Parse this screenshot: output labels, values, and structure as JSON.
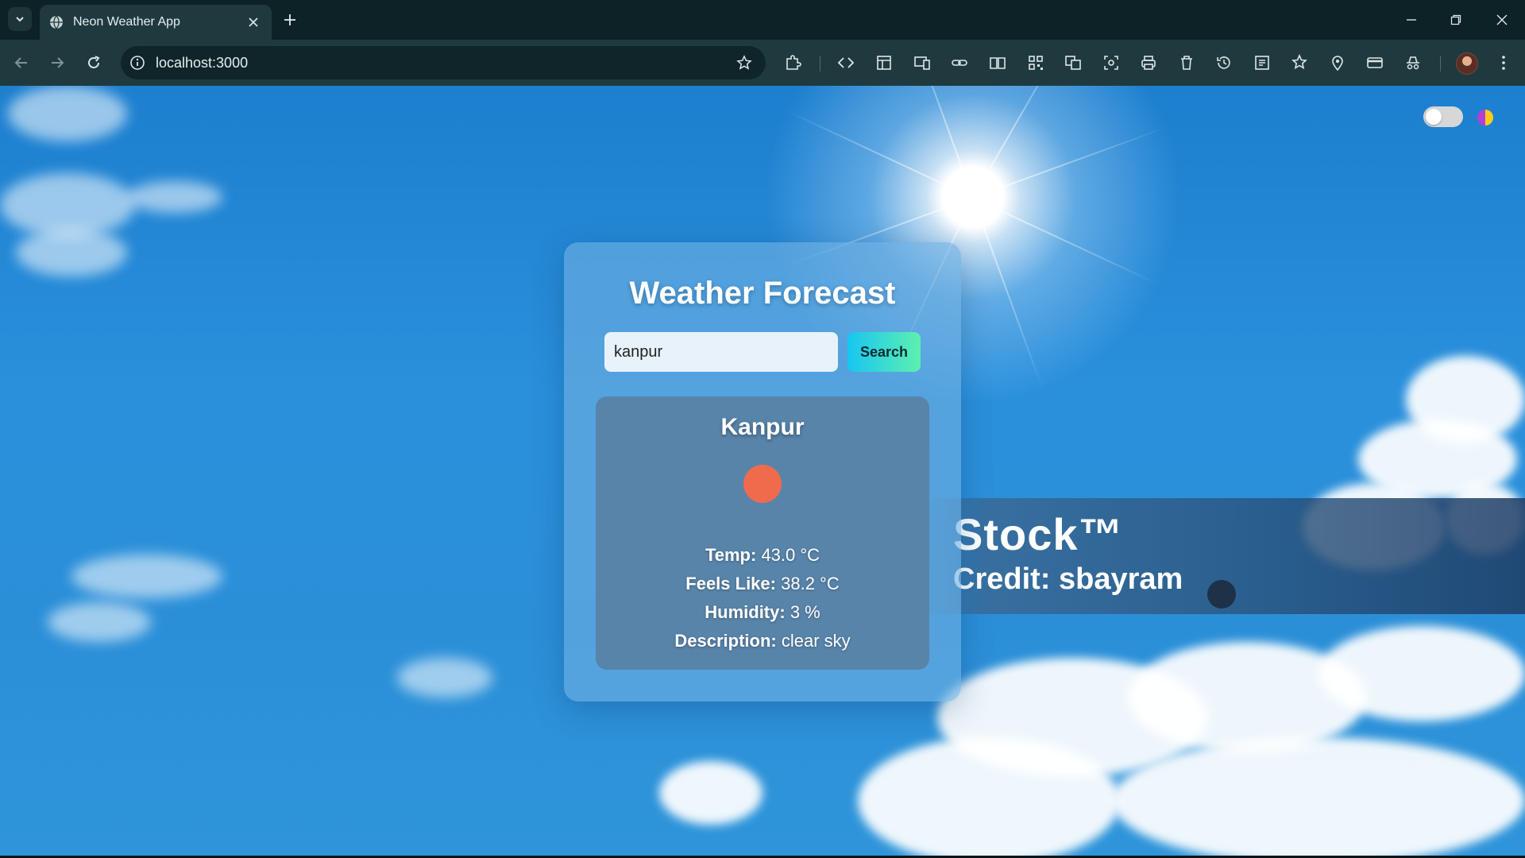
{
  "browser": {
    "tab_title": "Neon Weather App",
    "url": "localhost:3000"
  },
  "app": {
    "title": "Weather Forecast",
    "search": {
      "value": "kanpur",
      "button_label": "Search"
    },
    "result": {
      "city": "Kanpur",
      "icon": "sun-icon",
      "temp_label": "Temp:",
      "temp_value": "43.0 °C",
      "feels_like_label": "Feels Like:",
      "feels_like_value": "38.2 °C",
      "humidity_label": "Humidity:",
      "humidity_value": "3 %",
      "description_label": "Description:",
      "description_value": "clear sky"
    },
    "theme_toggle": {
      "state": "off"
    }
  },
  "background": {
    "watermark_line1": "Stock™",
    "watermark_line2": "Credit: sbayram"
  },
  "colors": {
    "icon_sun": "#f06b4c",
    "button_gradient_start": "#17c6f0",
    "button_gradient_end": "#5df0b0"
  }
}
